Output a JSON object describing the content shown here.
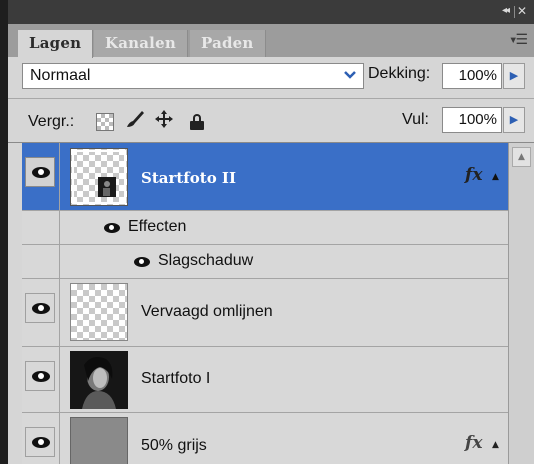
{
  "window": {
    "collapse_glyph": "◂◂",
    "close_glyph": "✕"
  },
  "tabs": [
    {
      "label": "Lagen",
      "active": true
    },
    {
      "label": "Kanalen",
      "active": false
    },
    {
      "label": "Paden",
      "active": false
    }
  ],
  "panel_menu_icon": "panel-menu-icon",
  "blend_mode": {
    "value": "Normaal"
  },
  "opacity": {
    "label": "Dekking:",
    "value": "100%"
  },
  "lock": {
    "label": "Vergr.:"
  },
  "fill": {
    "label": "Vul:",
    "value": "100%"
  },
  "layers": [
    {
      "name": "Startfoto II",
      "selected": true,
      "visible": true,
      "has_fx": true
    },
    {
      "name": "Vervaagd omlijnen",
      "selected": false,
      "visible": true,
      "has_fx": false
    },
    {
      "name": "Startfoto I",
      "selected": false,
      "visible": true,
      "has_fx": false
    },
    {
      "name": "50% grijs",
      "selected": false,
      "visible": true,
      "has_fx": true
    }
  ],
  "effects": {
    "group_label": "Effecten",
    "items": [
      {
        "label": "Slagschaduw"
      }
    ]
  },
  "glyphs": {
    "fx": "fx",
    "fx_toggle": "▲",
    "dropdown": "⌄",
    "stepper": "▶",
    "scroll_up": "▲"
  },
  "colors": {
    "selection": "#3a6fc7",
    "accent_arrow": "#2d5fb3"
  }
}
